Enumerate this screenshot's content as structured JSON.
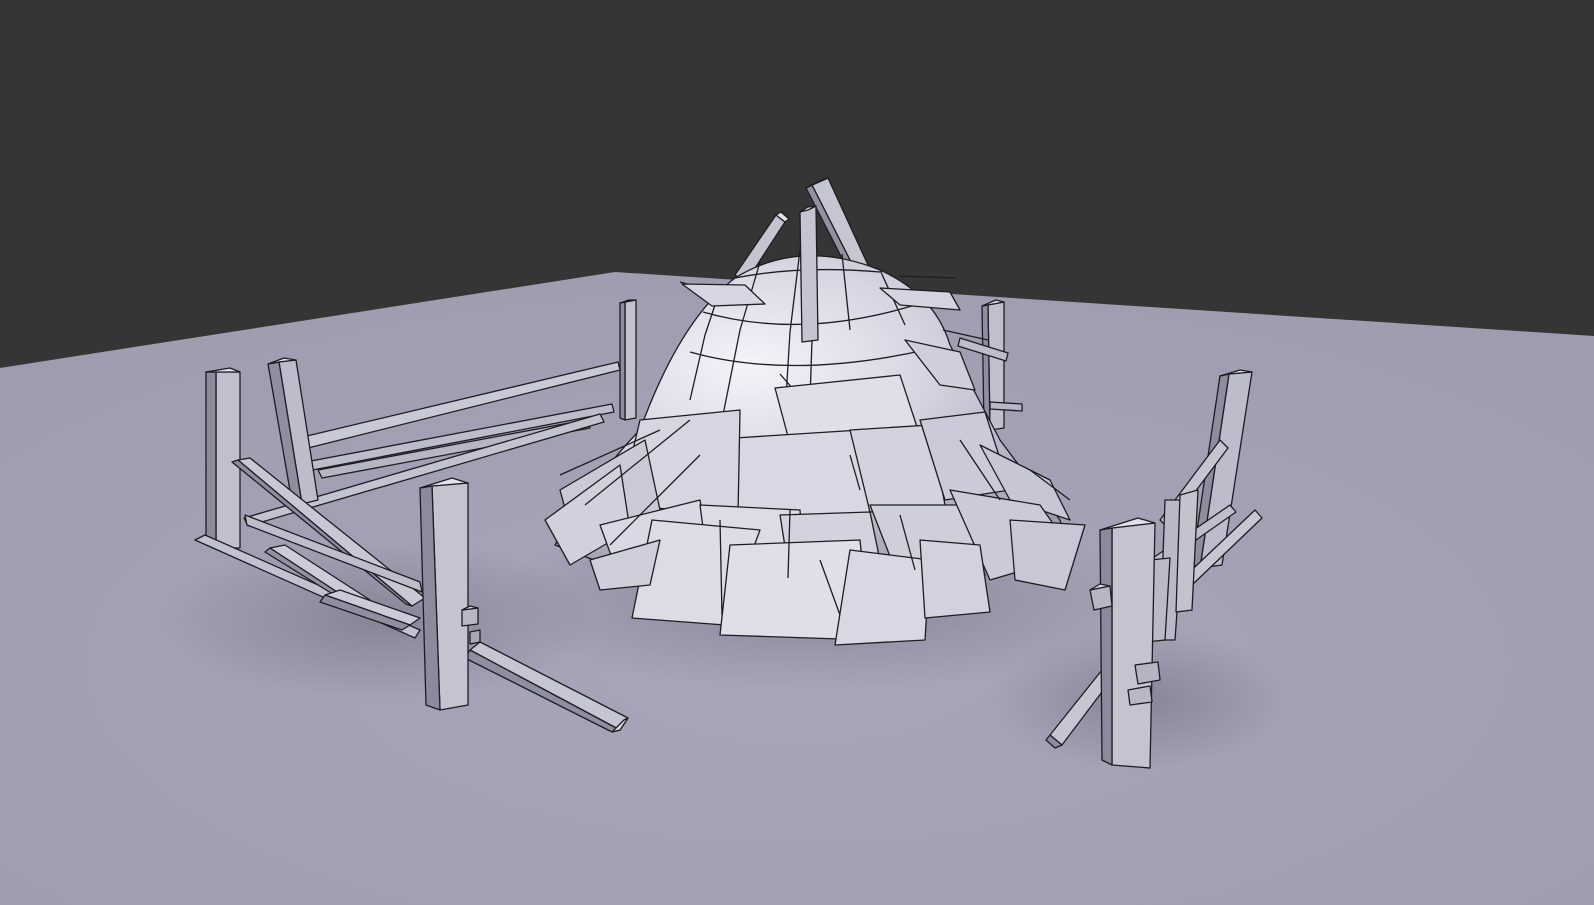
{
  "scene": {
    "background_color": "#353535",
    "ground_color": "#a19fb1",
    "model_color": "#cfcedb",
    "wire_color": "#1c1c22",
    "objects": [
      "conical-thatched-hut",
      "left-fence",
      "back-left-post",
      "back-right-post",
      "right-fence"
    ]
  }
}
